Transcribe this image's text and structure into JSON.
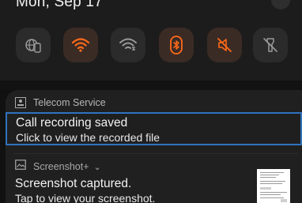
{
  "status": {
    "date": "Mon, Sep 17"
  },
  "quick_settings": {
    "tiles": [
      {
        "icon": "world-phone-icon",
        "state": "off"
      },
      {
        "icon": "wifi-icon",
        "state": "on"
      },
      {
        "icon": "wifi-calling-icon",
        "state": "off"
      },
      {
        "icon": "bluetooth-icon",
        "state": "on"
      },
      {
        "icon": "sound-muted-icon",
        "state": "on"
      },
      {
        "icon": "flashlight-off-icon",
        "state": "off"
      }
    ],
    "accent_color": "#ff6a1a"
  },
  "notifications": {
    "telecom": {
      "app_name": "Telecom Service",
      "entries": [
        {
          "title": "Call recording saved",
          "text": "Click to view the recorded file"
        }
      ]
    },
    "screenshot": {
      "app_name": "Screenshot+",
      "title": "Screenshot captured.",
      "text": "Tap to view your screenshot."
    }
  },
  "colors": {
    "focus_border": "#2f73bd"
  }
}
